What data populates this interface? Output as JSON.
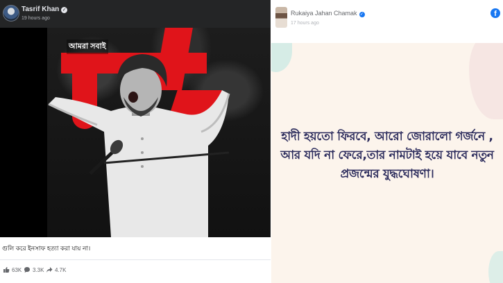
{
  "left_post": {
    "author": "Tasrif Khan",
    "time": "19 hours ago",
    "image_tagline": "আমরা সবাই",
    "caption": "গুলি করে ইনসাফ হত্যা করা যায় না।",
    "stats": {
      "reactions": "63K",
      "comments": "3.3K",
      "shares": "4.7K"
    }
  },
  "right_post": {
    "author": "Rukaiya Jahan Chamak",
    "time": "17 hours ago",
    "quote_lines": [
      "হাদী হয়তো ফিরবে, আরো জোরালো গর্জনে ,",
      "আর যদি না ফেরে,তার নামটাই হয়ে যাবে নতুন",
      "প্রজন্মের যুদ্ধঘোষণা।"
    ]
  },
  "icons": {
    "verified": "verified-badge-icon",
    "facebook": "facebook-logo-icon",
    "like": "like-icon",
    "comment": "comment-icon",
    "share": "share-icon"
  },
  "colors": {
    "accent_red": "#e0141a",
    "facebook_blue": "#1877f2",
    "quote_text": "#2b2b5c"
  }
}
